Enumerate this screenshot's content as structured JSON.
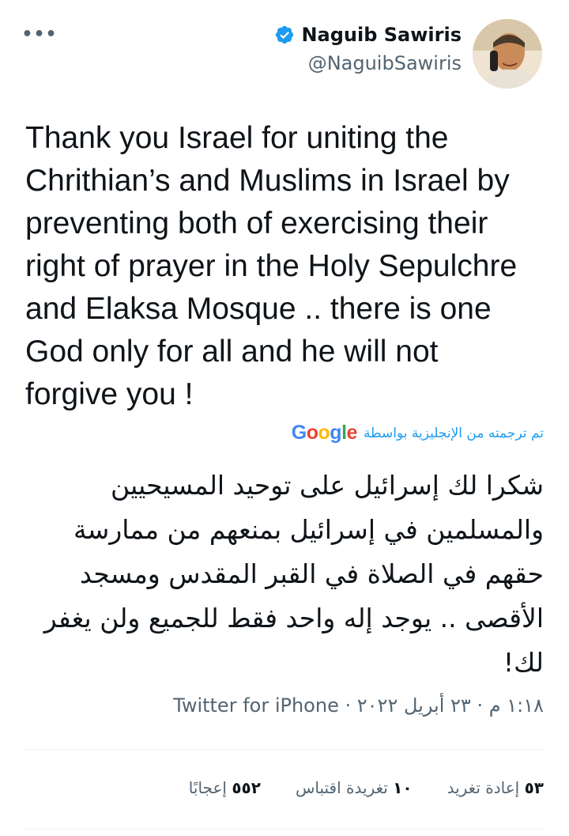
{
  "header": {
    "more_icon": "more-horizontal-icon",
    "more_glyph": "•••"
  },
  "author": {
    "display_name": "Naguib Sawiris",
    "handle": "@NaguibSawiris",
    "verified_icon": "verified-badge-icon",
    "verified_color": "#1d9bf0"
  },
  "tweet": {
    "text": "Thank you Israel for uniting the Chrithian’s and Muslims in Israel by preventing both of exercising their right of prayer in the Holy Sepulchre and Elaksa Mosque .. there is one God only for all and he will not forgive you !",
    "translated_by_label": "تم ترجمته من الإنجليزية بواسطة",
    "translation_provider": "Google",
    "translation": "شكرا لك إسرائيل على توحيد المسيحيين والمسلمين في إسرائيل بمنعهم من ممارسة حقهم في الصلاة في القبر المقدس ومسجد الأقصى .. يوجد إله واحد فقط للجميع ولن يغفر لك!"
  },
  "meta": {
    "time": "١:١٨ م",
    "date": "٢٣ أبريل ٢٠٢٢",
    "separator": "·",
    "source": "Twitter for iPhone"
  },
  "stats": {
    "retweets_count": "٥٣",
    "retweets_label": "إعادة تغريد",
    "quotes_count": "١٠",
    "quotes_label": "تغريدة اقتباس",
    "likes_count": "٥٥٢",
    "likes_label": "إعجابًا"
  },
  "colors": {
    "accent": "#1d9bf0",
    "secondary_text": "#536471",
    "primary_text": "#0f1419",
    "divider": "#eff3f4"
  }
}
